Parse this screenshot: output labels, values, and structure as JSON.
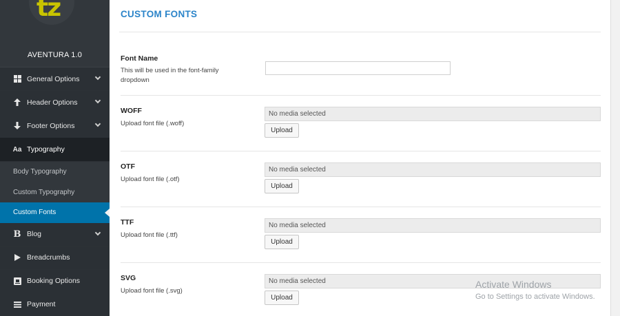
{
  "sidebar": {
    "logo_text": "tz",
    "theme_name": "AVENTURA 1.0",
    "items": [
      {
        "label": "General Options",
        "icon": "grid-icon"
      },
      {
        "label": "Header Options",
        "icon": "arrow-up-icon"
      },
      {
        "label": "Footer Options",
        "icon": "arrow-down-icon"
      },
      {
        "label": "Typography",
        "icon": "typography-icon"
      },
      {
        "label": "Blog",
        "icon": "bold-b-icon"
      },
      {
        "label": "Breadcrumbs",
        "icon": "play-icon"
      },
      {
        "label": "Booking Options",
        "icon": "booking-icon"
      },
      {
        "label": "Payment",
        "icon": "payment-icon"
      }
    ],
    "typography_icon_text": "Aa",
    "blog_icon_text": "B",
    "submenu": [
      {
        "label": "Body Typography"
      },
      {
        "label": "Custom Typography"
      },
      {
        "label": "Custom Fonts"
      }
    ]
  },
  "main": {
    "section_title": "CUSTOM FONTS",
    "font_name": {
      "label": "Font Name",
      "description": "This will be used in the font-family dropdown",
      "value": ""
    },
    "fields": [
      {
        "label": "WOFF",
        "description": "Upload font file (.woff)",
        "media_text": "No media selected",
        "button": "Upload"
      },
      {
        "label": "OTF",
        "description": "Upload font file (.otf)",
        "media_text": "No media selected",
        "button": "Upload"
      },
      {
        "label": "TTF",
        "description": "Upload font file (.ttf)",
        "media_text": "No media selected",
        "button": "Upload"
      },
      {
        "label": "SVG",
        "description": "Upload font file (.svg)",
        "media_text": "No media selected",
        "button": "Upload"
      }
    ]
  },
  "watermark": {
    "line1": "Activate Windows",
    "line2": "Go to Settings to activate Windows."
  },
  "colors": {
    "sidebar_bg": "#23282d",
    "accent_blue": "#0073aa",
    "title_blue": "#2b84c9",
    "logo_yellow": "#c8c400"
  }
}
